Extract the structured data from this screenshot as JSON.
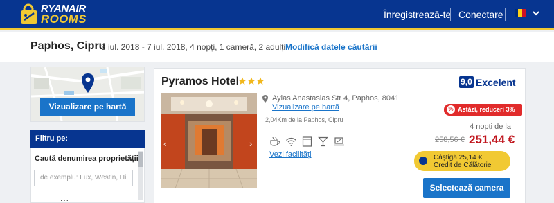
{
  "header": {
    "logo_line1": "RYANAIR",
    "logo_line2": "ROOMS",
    "register_label": "Înregistrează-te",
    "login_label": "Conectare",
    "colors": {
      "bar": "#073590",
      "accent": "#f1c933"
    }
  },
  "search": {
    "city": "Paphos, Cipru",
    "details": "3 iul. 2018 - 7 iul. 2018, 4 nopți, 1 cameră, 2 adulți",
    "modify_label": "Modifică datele căutării"
  },
  "sidebar": {
    "map_button_label": "Vizualizare pe hartă",
    "filter_title": "Filtru pe:",
    "filter_name_label": "Caută denumirea proprietății",
    "filter_name_placeholder": "de exemplu: Lux, Westin, Hi",
    "filter_more": "..."
  },
  "hotel": {
    "name": "Pyramos Hotel",
    "stars": 3,
    "address": "Ayias Anastasias Str 4, Paphos, 8041",
    "map_link_label": "Vizualizare pe hartă",
    "distance": "2,04Km de la Paphos, Cipru",
    "amenity_icons": [
      "coffee-icon",
      "wifi-icon",
      "elevator-icon",
      "bar-icon",
      "laptop-icon"
    ],
    "facilities_label": "Vezi facilități",
    "rating_score": "9,0",
    "rating_label": "Excelent",
    "deal_label": "Astăzi, reduceri 3%",
    "nights_label": "4 nopți de la",
    "old_price": "258,56 €",
    "new_price": "251,44 €",
    "cashback_line1": "Câștigă 25,14 €",
    "cashback_line2": "Credit de Călătorie",
    "select_button_label": "Selectează camera",
    "colors": {
      "price": "#c0151d",
      "deal": "#e12b2b",
      "link": "#1a74c9"
    }
  }
}
